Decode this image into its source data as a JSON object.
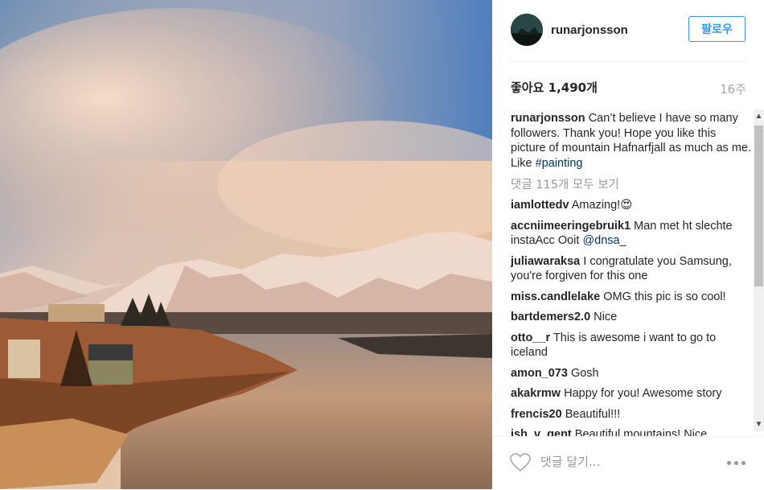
{
  "post": {
    "username": "runarjonsson",
    "follow_label": "팔로우",
    "likes_label": "좋아요",
    "likes_count": "1,490개",
    "time_ago": "16주"
  },
  "caption": {
    "user": "runarjonsson",
    "text": "Can’t believe I have so many followers. Thank you! Hope you like this picture of mountain Hafnarfjall as much as me. Like ",
    "hashtag": "#painting"
  },
  "view_all_comments": "댓글 115개 모두 보기",
  "comments": [
    {
      "user": "iamlottedv",
      "text": "Amazing!😍"
    },
    {
      "user": "accniimeeringebruik1",
      "text": "Man met ht slechte instaAcc Ooit ",
      "mention": "@dnsa_"
    },
    {
      "user": "juliawaraksa",
      "text": "I congratulate you Samsung, you're forgiven for this one"
    },
    {
      "user": "miss.candlelake",
      "text": "OMG this pic is so cool!"
    },
    {
      "user": "bartdemers2.0",
      "text": "Nice"
    },
    {
      "user": "otto__r",
      "text": "This is awesome i want to go to iceland"
    },
    {
      "user": "amon_073",
      "text": "Gosh"
    },
    {
      "user": "akakrmw",
      "text": "Happy for you! Awesome story"
    },
    {
      "user": "frencis20",
      "text": "Beautiful!!!"
    },
    {
      "user": "ish_v_gent",
      "text": "Beautiful mountains! Nice"
    }
  ],
  "footer": {
    "comment_placeholder": "댓글 달기..."
  },
  "icons": {
    "like": "heart-icon",
    "more": "more-options-icon",
    "scroll_up": "scroll-up-arrow",
    "scroll_down": "scroll-down-arrow"
  },
  "colors": {
    "link": "#003569",
    "follow": "#3897f0"
  }
}
